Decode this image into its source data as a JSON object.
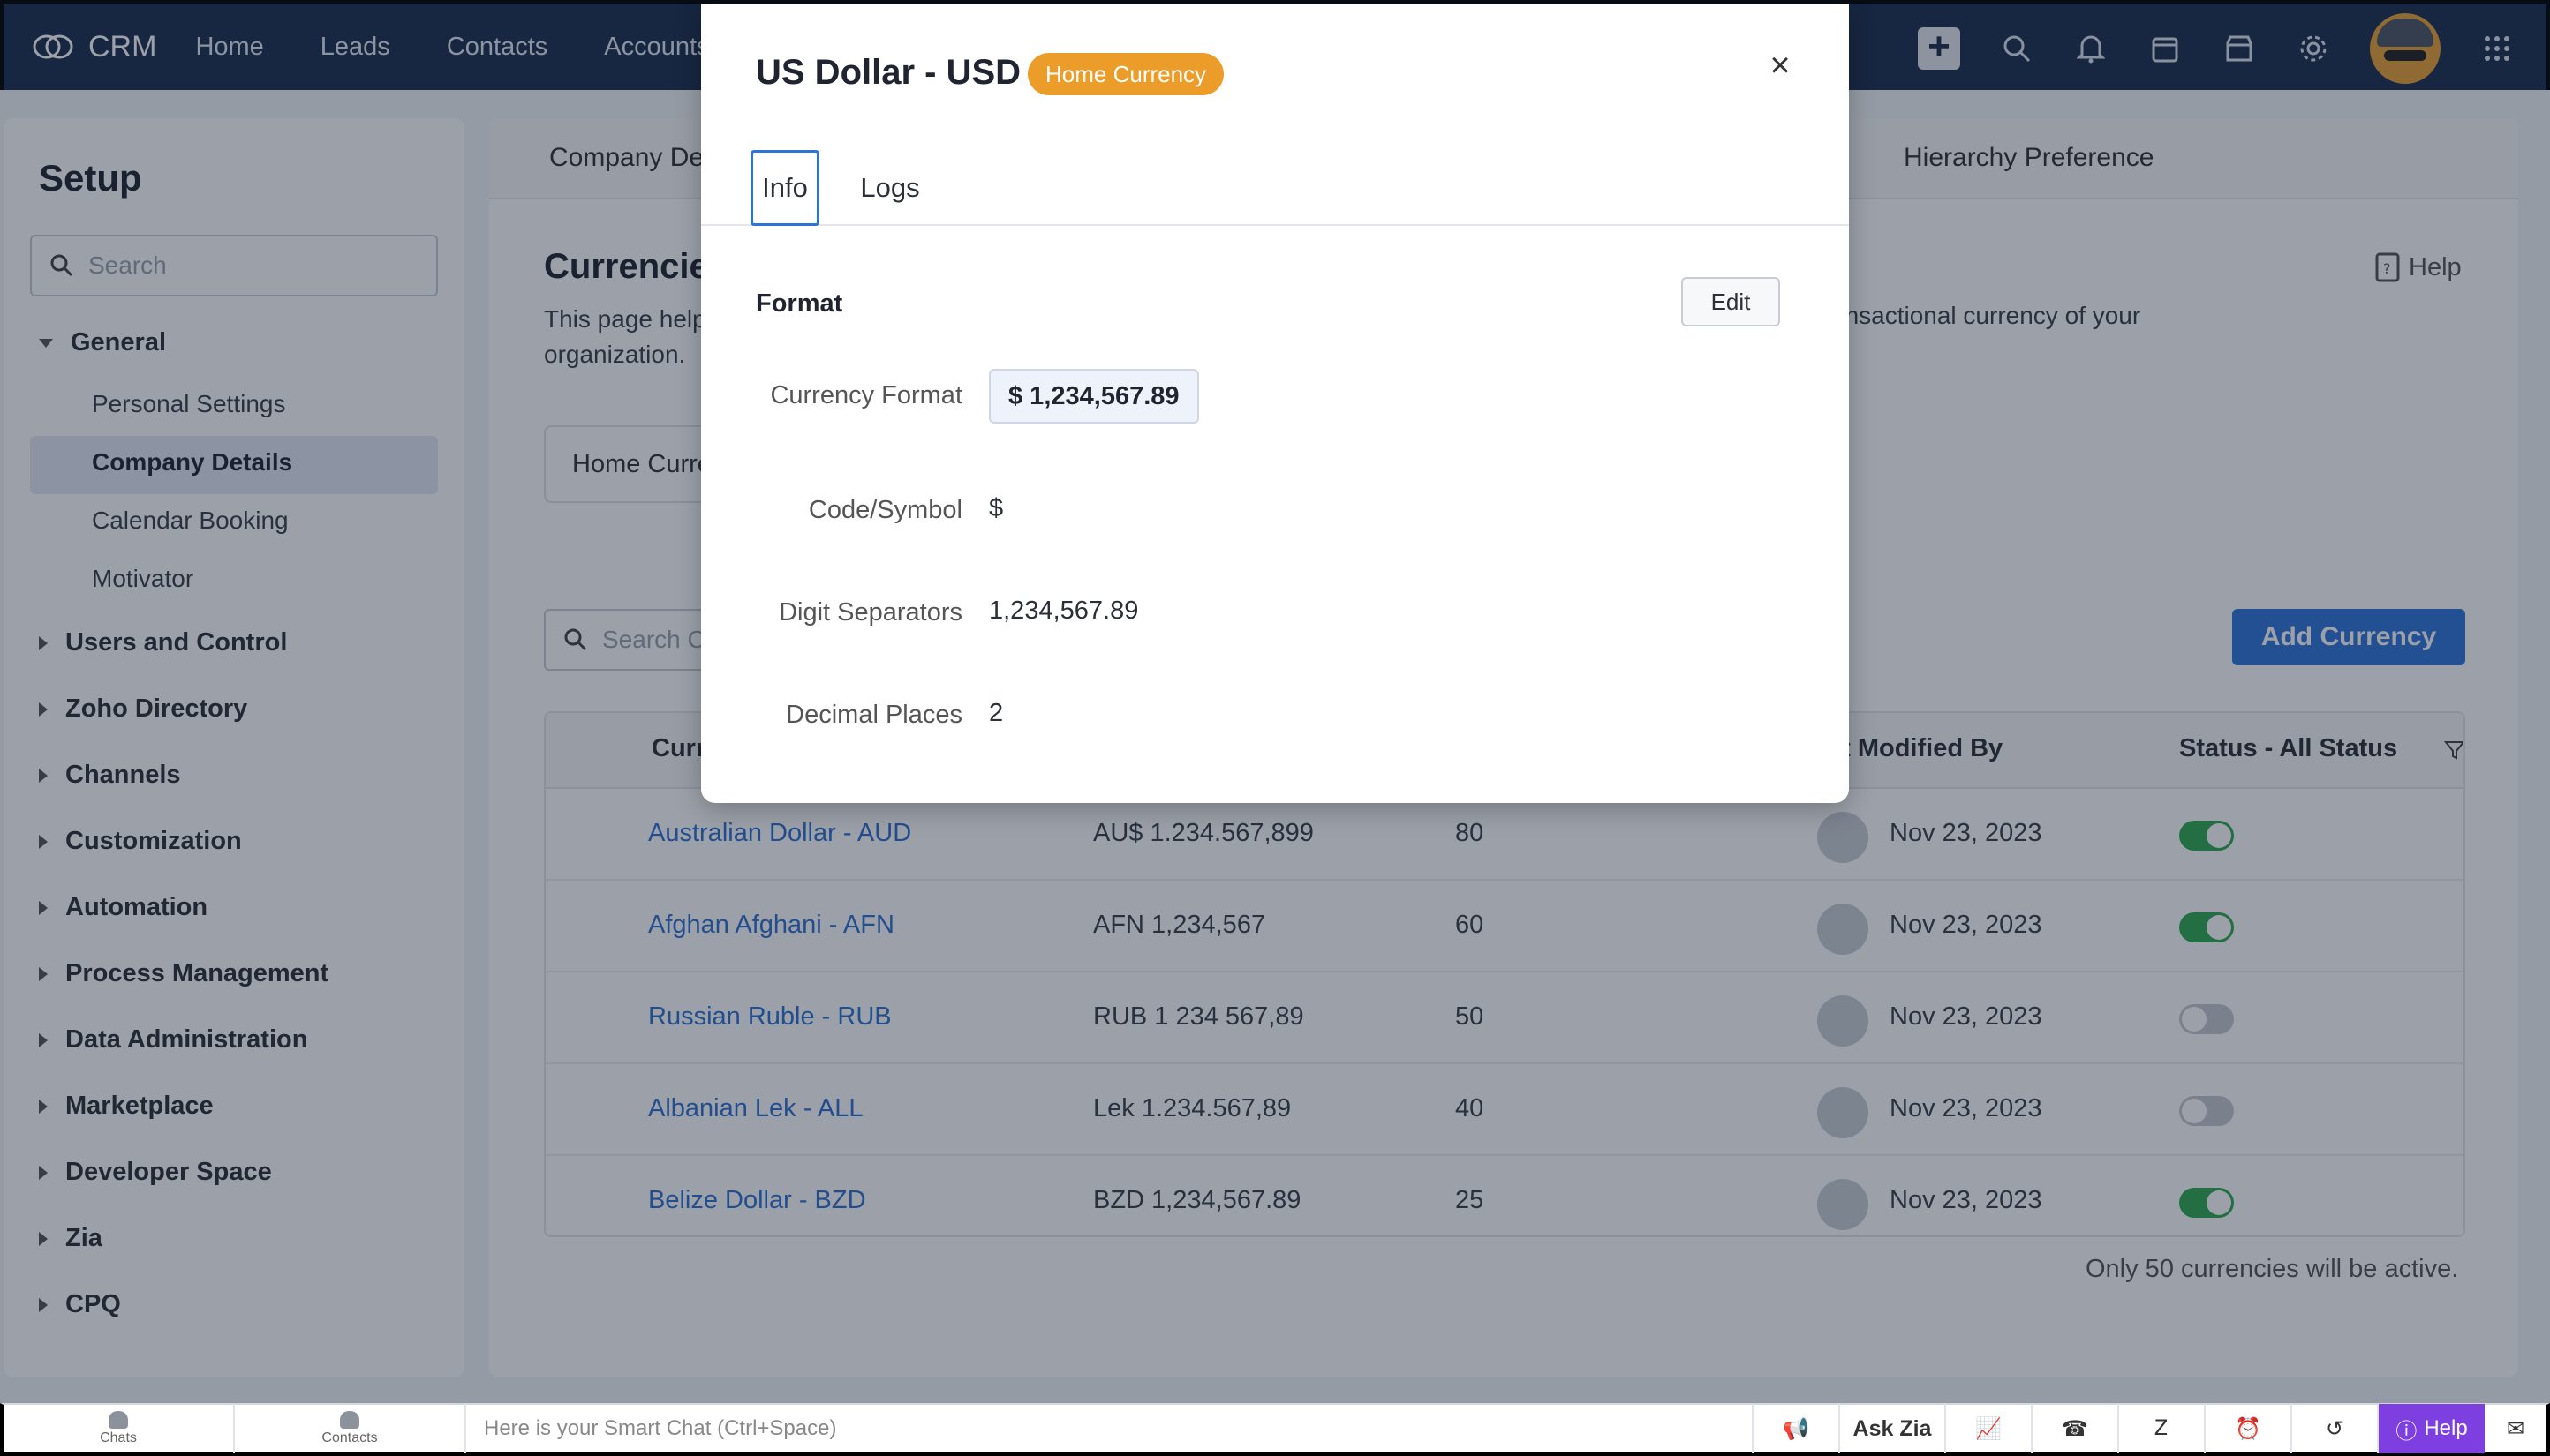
{
  "topbar": {
    "brand": "CRM",
    "nav": [
      "Home",
      "Leads",
      "Contacts",
      "Accounts"
    ],
    "icons": [
      "plus-icon",
      "search-icon",
      "bell-icon",
      "calendar-icon",
      "store-icon",
      "gear-icon",
      "avatar",
      "apps-grid-icon"
    ]
  },
  "sidebar": {
    "title": "Setup",
    "search_placeholder": "Search",
    "groups": [
      {
        "label": "General",
        "expanded": true,
        "items": [
          "Personal Settings",
          "Company Details",
          "Calendar Booking",
          "Motivator"
        ],
        "active": "Company Details"
      },
      {
        "label": "Users and Control"
      },
      {
        "label": "Zoho Directory"
      },
      {
        "label": "Channels"
      },
      {
        "label": "Customization"
      },
      {
        "label": "Automation"
      },
      {
        "label": "Process Management"
      },
      {
        "label": "Data Administration"
      },
      {
        "label": "Marketplace"
      },
      {
        "label": "Developer Space"
      },
      {
        "label": "Zia"
      },
      {
        "label": "CPQ"
      }
    ]
  },
  "main": {
    "tab_left": "Company De",
    "tab_right": "Hierarchy Preference",
    "heading": "Currencie",
    "desc_left": "This page help",
    "desc_right": "ansactional currency of your",
    "desc_line2": "organization.",
    "help": "Help",
    "home_currency_label": "Home Curre",
    "search_placeholder": "Search C",
    "add_button": "Add Currency",
    "columns": {
      "currency": "Curre",
      "modified": "st Modified By",
      "status": "Status - All Status"
    },
    "rows": [
      {
        "name": "Australian Dollar - AUD",
        "format": "AU$ 1.234.567,899",
        "rate": "80",
        "date": "Nov 23, 2023",
        "active": true
      },
      {
        "name": "Afghan Afghani - AFN",
        "format": "AFN 1,234,567",
        "rate": "60",
        "date": "Nov 23, 2023",
        "active": true
      },
      {
        "name": "Russian Ruble - RUB",
        "format": "RUB 1 234 567,89",
        "rate": "50",
        "date": "Nov 23, 2023",
        "active": false
      },
      {
        "name": "Albanian Lek - ALL",
        "format": "Lek 1.234.567,89",
        "rate": "40",
        "date": "Nov 23, 2023",
        "active": false
      },
      {
        "name": "Belize Dollar - BZD",
        "format": "BZD 1,234,567.89",
        "rate": "25",
        "date": "Nov 23, 2023",
        "active": true
      }
    ],
    "footnote": "Only 50 currencies will be active."
  },
  "modal": {
    "title": "US Dollar - USD",
    "badge": "Home Currency",
    "close": "×",
    "tabs": [
      "Info",
      "Logs"
    ],
    "active_tab": "Info",
    "section": "Format",
    "edit": "Edit",
    "fields": [
      {
        "label": "Currency Format",
        "value": "$ 1,234,567.89"
      },
      {
        "label": "Code/Symbol",
        "value": "$"
      },
      {
        "label": "Digit Separators",
        "value": "1,234,567.89"
      },
      {
        "label": "Decimal Places",
        "value": "2"
      }
    ]
  },
  "bottombar": {
    "chats": "Chats",
    "contacts": "Contacts",
    "smartchat_placeholder": "Here is your Smart Chat (Ctrl+Space)",
    "ask_zia": "Ask Zia",
    "help": "Help"
  },
  "colors": {
    "nav_bg": "#1a2b4c",
    "accent": "#2d74da",
    "badge": "#ec9c29",
    "toggle_on": "#2fa84f",
    "help_purple": "#7e3fe0"
  }
}
